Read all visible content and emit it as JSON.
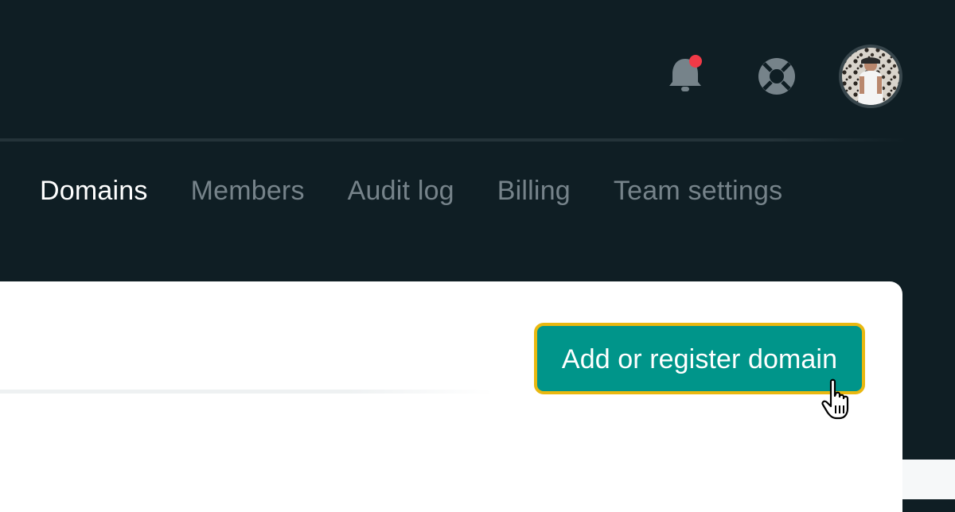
{
  "header": {
    "notifications_icon": "bell-icon",
    "notification_badge_color": "#f03a47",
    "help_icon": "lifebuoy-icon",
    "avatar": "user-avatar"
  },
  "tabs": [
    {
      "label": "Domains",
      "active": true
    },
    {
      "label": "Members",
      "active": false
    },
    {
      "label": "Audit log",
      "active": false
    },
    {
      "label": "Billing",
      "active": false
    },
    {
      "label": "Team settings",
      "active": false
    }
  ],
  "main": {
    "add_domain_label": "Add or register domain"
  },
  "colors": {
    "header_bg": "#0f1e24",
    "accent": "#00958a",
    "focus_ring": "#e9b810",
    "tab_inactive": "#76838a",
    "tab_active": "#ffffff"
  }
}
